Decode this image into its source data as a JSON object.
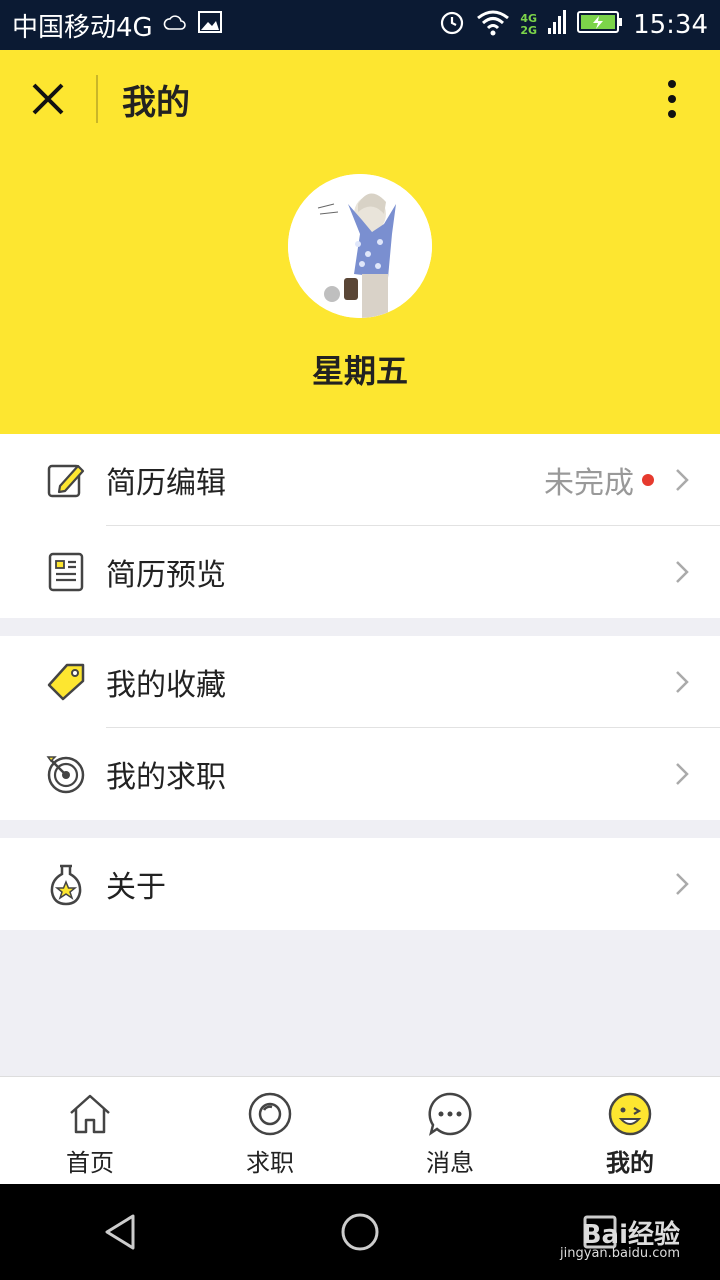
{
  "status_bar": {
    "carrier": "中国移动4G",
    "net_4g": "4G",
    "net_2g": "2G",
    "time": "15:34"
  },
  "header": {
    "title": "我的",
    "username": "星期五"
  },
  "menu": {
    "resume_edit": {
      "label": "简历编辑",
      "status": "未完成"
    },
    "resume_preview": {
      "label": "简历预览"
    },
    "favorites": {
      "label": "我的收藏"
    },
    "applications": {
      "label": "我的求职"
    },
    "about": {
      "label": "关于"
    }
  },
  "tabbar": {
    "items": [
      {
        "label": "首页",
        "icon": "home-icon"
      },
      {
        "label": "求职",
        "icon": "target-icon"
      },
      {
        "label": "消息",
        "icon": "message-icon"
      },
      {
        "label": "我的",
        "icon": "smiley-icon",
        "active": true
      }
    ]
  },
  "watermark": {
    "brand": "Bai经验",
    "url": "jingyan.baidu.com"
  },
  "colors": {
    "accent": "#fde630",
    "status_bar": "#0b1a33",
    "badge": "#e63a2e"
  }
}
